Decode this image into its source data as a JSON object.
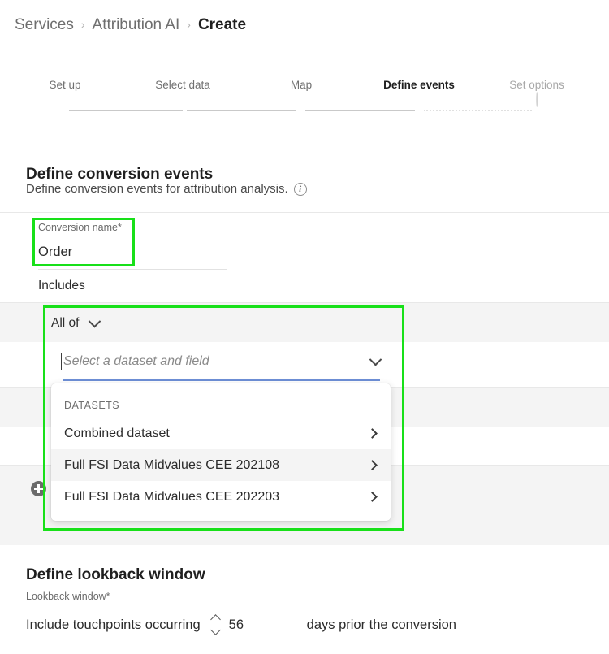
{
  "breadcrumb": {
    "items": [
      {
        "label": "Services",
        "current": false
      },
      {
        "label": "Attribution AI",
        "current": false
      },
      {
        "label": "Create",
        "current": true
      }
    ],
    "separator": "›"
  },
  "stepper": {
    "steps": [
      {
        "label": "Set up",
        "state": "done"
      },
      {
        "label": "Select data",
        "state": "done"
      },
      {
        "label": "Map",
        "state": "done"
      },
      {
        "label": "Define events",
        "state": "active"
      },
      {
        "label": "Set options",
        "state": "upcoming"
      }
    ]
  },
  "conversion_section": {
    "title": "Define conversion events",
    "subtitle": "Define conversion events for attribution analysis.",
    "info_icon": "info-icon",
    "info_icon_glyph": "i"
  },
  "event_card": {
    "conversion_name_label": "Conversion name*",
    "conversion_name_value": "Order",
    "includes_label": "Includes",
    "match_mode": "All of",
    "match_mode_icon": "chevron-down-icon",
    "add_condition_icon": "plus-circle-icon"
  },
  "dataset_select": {
    "placeholder": "Select a dataset and field",
    "value": "",
    "chevron_icon": "chevron-down-icon",
    "focus_color": "#6d8fd6"
  },
  "dropdown": {
    "group_header": "DATASETS",
    "items": [
      {
        "label": "Combined dataset",
        "hovered": false,
        "chevron_icon": "chevron-right-icon"
      },
      {
        "label": "Full FSI Data Midvalues CEE 202108",
        "hovered": true,
        "chevron_icon": "chevron-right-icon"
      },
      {
        "label": "Full FSI Data Midvalues CEE 202203",
        "hovered": false,
        "chevron_icon": "chevron-right-icon"
      }
    ]
  },
  "lookback_section": {
    "title": "Define lookback window",
    "field_label": "Lookback window*",
    "prefix_text": "Include touchpoints occurring",
    "value": "56",
    "suffix_text": "days prior the conversion",
    "stepper_up_icon": "chevron-up-icon",
    "stepper_down_icon": "chevron-down-icon"
  },
  "annotations": {
    "highlight_color": "#18e019",
    "boxes": [
      {
        "name": "conversion-name-highlight"
      },
      {
        "name": "condition-group-highlight"
      }
    ]
  }
}
